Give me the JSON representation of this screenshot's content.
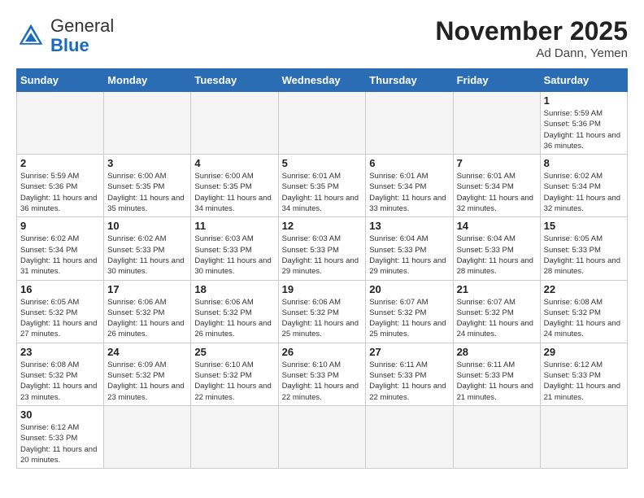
{
  "header": {
    "logo_general": "General",
    "logo_blue": "Blue",
    "month_title": "November 2025",
    "location": "Ad Dann, Yemen"
  },
  "weekdays": [
    "Sunday",
    "Monday",
    "Tuesday",
    "Wednesday",
    "Thursday",
    "Friday",
    "Saturday"
  ],
  "days": [
    {
      "date": 1,
      "sunrise": "5:59 AM",
      "sunset": "5:36 PM",
      "daylight": "11 hours and 36 minutes."
    },
    {
      "date": 2,
      "sunrise": "5:59 AM",
      "sunset": "5:36 PM",
      "daylight": "11 hours and 36 minutes."
    },
    {
      "date": 3,
      "sunrise": "6:00 AM",
      "sunset": "5:35 PM",
      "daylight": "11 hours and 35 minutes."
    },
    {
      "date": 4,
      "sunrise": "6:00 AM",
      "sunset": "5:35 PM",
      "daylight": "11 hours and 34 minutes."
    },
    {
      "date": 5,
      "sunrise": "6:01 AM",
      "sunset": "5:35 PM",
      "daylight": "11 hours and 34 minutes."
    },
    {
      "date": 6,
      "sunrise": "6:01 AM",
      "sunset": "5:34 PM",
      "daylight": "11 hours and 33 minutes."
    },
    {
      "date": 7,
      "sunrise": "6:01 AM",
      "sunset": "5:34 PM",
      "daylight": "11 hours and 32 minutes."
    },
    {
      "date": 8,
      "sunrise": "6:02 AM",
      "sunset": "5:34 PM",
      "daylight": "11 hours and 32 minutes."
    },
    {
      "date": 9,
      "sunrise": "6:02 AM",
      "sunset": "5:34 PM",
      "daylight": "11 hours and 31 minutes."
    },
    {
      "date": 10,
      "sunrise": "6:02 AM",
      "sunset": "5:33 PM",
      "daylight": "11 hours and 30 minutes."
    },
    {
      "date": 11,
      "sunrise": "6:03 AM",
      "sunset": "5:33 PM",
      "daylight": "11 hours and 30 minutes."
    },
    {
      "date": 12,
      "sunrise": "6:03 AM",
      "sunset": "5:33 PM",
      "daylight": "11 hours and 29 minutes."
    },
    {
      "date": 13,
      "sunrise": "6:04 AM",
      "sunset": "5:33 PM",
      "daylight": "11 hours and 29 minutes."
    },
    {
      "date": 14,
      "sunrise": "6:04 AM",
      "sunset": "5:33 PM",
      "daylight": "11 hours and 28 minutes."
    },
    {
      "date": 15,
      "sunrise": "6:05 AM",
      "sunset": "5:33 PM",
      "daylight": "11 hours and 28 minutes."
    },
    {
      "date": 16,
      "sunrise": "6:05 AM",
      "sunset": "5:32 PM",
      "daylight": "11 hours and 27 minutes."
    },
    {
      "date": 17,
      "sunrise": "6:06 AM",
      "sunset": "5:32 PM",
      "daylight": "11 hours and 26 minutes."
    },
    {
      "date": 18,
      "sunrise": "6:06 AM",
      "sunset": "5:32 PM",
      "daylight": "11 hours and 26 minutes."
    },
    {
      "date": 19,
      "sunrise": "6:06 AM",
      "sunset": "5:32 PM",
      "daylight": "11 hours and 25 minutes."
    },
    {
      "date": 20,
      "sunrise": "6:07 AM",
      "sunset": "5:32 PM",
      "daylight": "11 hours and 25 minutes."
    },
    {
      "date": 21,
      "sunrise": "6:07 AM",
      "sunset": "5:32 PM",
      "daylight": "11 hours and 24 minutes."
    },
    {
      "date": 22,
      "sunrise": "6:08 AM",
      "sunset": "5:32 PM",
      "daylight": "11 hours and 24 minutes."
    },
    {
      "date": 23,
      "sunrise": "6:08 AM",
      "sunset": "5:32 PM",
      "daylight": "11 hours and 23 minutes."
    },
    {
      "date": 24,
      "sunrise": "6:09 AM",
      "sunset": "5:32 PM",
      "daylight": "11 hours and 23 minutes."
    },
    {
      "date": 25,
      "sunrise": "6:10 AM",
      "sunset": "5:32 PM",
      "daylight": "11 hours and 22 minutes."
    },
    {
      "date": 26,
      "sunrise": "6:10 AM",
      "sunset": "5:33 PM",
      "daylight": "11 hours and 22 minutes."
    },
    {
      "date": 27,
      "sunrise": "6:11 AM",
      "sunset": "5:33 PM",
      "daylight": "11 hours and 22 minutes."
    },
    {
      "date": 28,
      "sunrise": "6:11 AM",
      "sunset": "5:33 PM",
      "daylight": "11 hours and 21 minutes."
    },
    {
      "date": 29,
      "sunrise": "6:12 AM",
      "sunset": "5:33 PM",
      "daylight": "11 hours and 21 minutes."
    },
    {
      "date": 30,
      "sunrise": "6:12 AM",
      "sunset": "5:33 PM",
      "daylight": "11 hours and 20 minutes."
    }
  ]
}
